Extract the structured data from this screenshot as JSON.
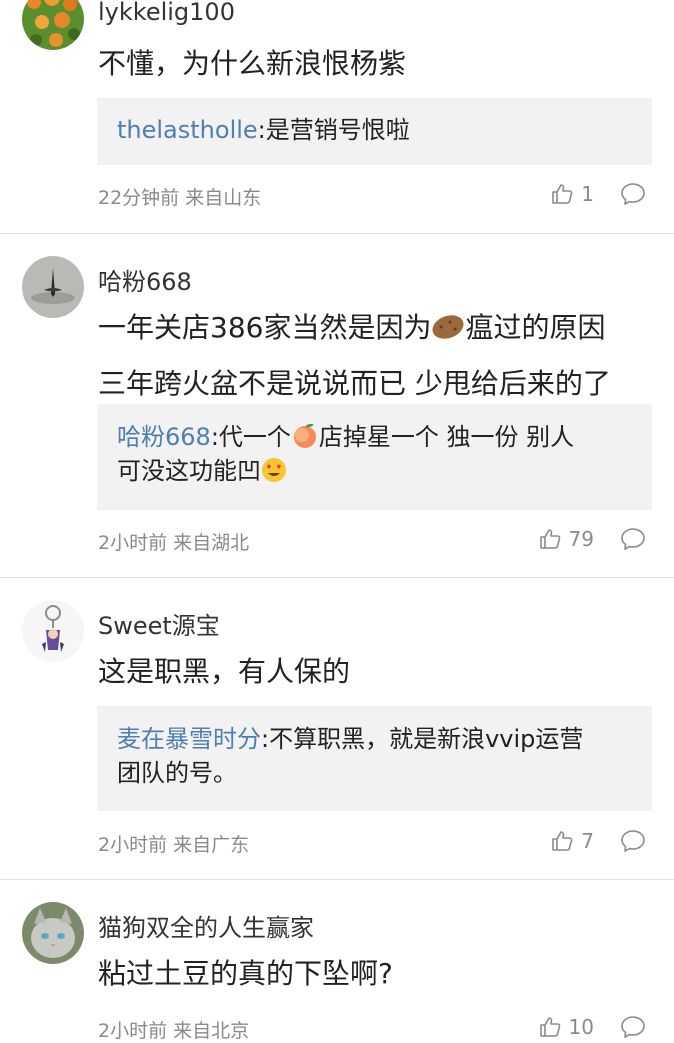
{
  "comments": [
    {
      "username": "lykkelig100",
      "text_lines": [
        "不懂，为什么新浪恨杨紫"
      ],
      "reply": {
        "user": "thelastholle",
        "sep": ":",
        "text": "是营销号恨啦"
      },
      "meta": "22分钟前 来自山东",
      "likes": "1"
    },
    {
      "username": "哈粉668",
      "text_lines": [
        "一年关店386家当然是因为",
        "瘟过的原因",
        "三年跨火盆不是说说而已 少甩给后来的了"
      ],
      "reply": {
        "user": "哈粉668",
        "sep": ":",
        "text_a": "代一个",
        "text_b": "店掉星一个 独一份 别人",
        "text_c": "可没这功能凹"
      },
      "meta": "2小时前 来自湖北",
      "likes": "79"
    },
    {
      "username": "Sweet源宝",
      "text_lines": [
        "这是职黑，有人保的"
      ],
      "reply": {
        "user": "麦在暴雪时分",
        "sep": ":",
        "text_a": "不算职黑，就是新浪vvip运营",
        "text_b": "团队的号。"
      },
      "meta": "2小时前 来自广东",
      "likes": "7"
    },
    {
      "username": "猫狗双全的人生赢家",
      "text_lines": [
        "粘过土豆的真的下坠啊?"
      ],
      "meta": "2小时前 来自北京",
      "likes": "10"
    }
  ],
  "icons": {
    "like": "thumbs-up-icon",
    "reply": "comment-bubble-icon",
    "potato": "potato-emoji",
    "peach": "peach-emoji",
    "heart_eyes": "heart-eyes-emoji"
  },
  "colors": {
    "reply_user": "#4f7fb0",
    "meta": "#8a8a8a",
    "reply_bg": "#f2f2f2"
  }
}
